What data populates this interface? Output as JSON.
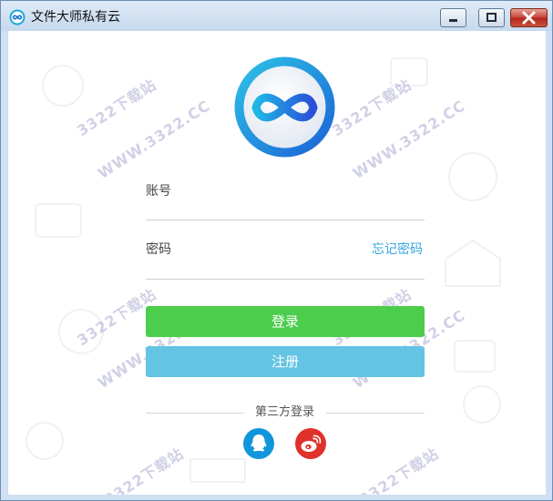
{
  "window": {
    "title": "文件大师私有云",
    "controls": {
      "minimize": "minimize",
      "maximize": "maximize",
      "close": "close"
    }
  },
  "watermark": [
    "3322下载站",
    "WWW.3322.CC"
  ],
  "form": {
    "account_label": "账号",
    "account_value": "",
    "password_label": "密码",
    "password_value": "",
    "forgot_password": "忘记密码",
    "login_button": "登录",
    "register_button": "注册"
  },
  "third_party": {
    "label": "第三方登录",
    "providers": [
      {
        "name": "QQ",
        "icon": "qq-icon",
        "color": "#1296db"
      },
      {
        "name": "Weibo",
        "icon": "weibo-icon",
        "color": "#e0312c"
      }
    ]
  },
  "colors": {
    "login": "#4ccd4c",
    "register": "#63c4e4",
    "link": "#38a6e0"
  }
}
